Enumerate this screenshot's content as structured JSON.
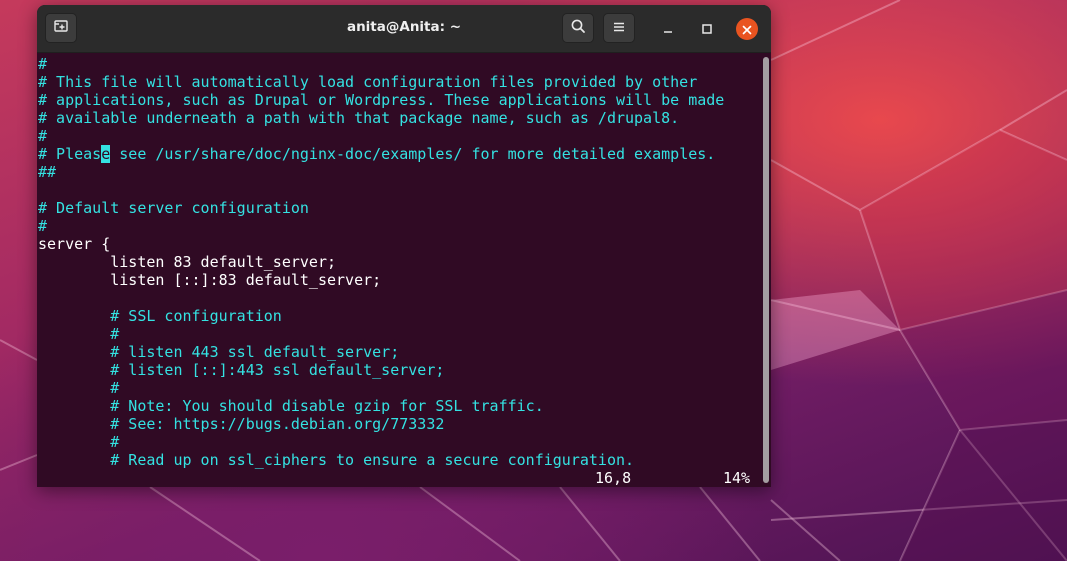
{
  "window": {
    "title": "anita@Anita: ~"
  },
  "icons": {
    "new_tab": "new-tab-icon",
    "search": "search-icon",
    "menu": "hamburger-menu-icon",
    "minimize": "minimize-icon",
    "maximize": "maximize-icon",
    "close": "close-icon"
  },
  "colors": {
    "terminal_bg": "#300a24",
    "comment": "#34e2e2",
    "close_button": "#e95420"
  },
  "editor": {
    "lines": [
      {
        "text": "#",
        "comment": true
      },
      {
        "text": "# This file will automatically load configuration files provided by other",
        "comment": true
      },
      {
        "text": "# applications, such as Drupal or Wordpress. These applications will be made",
        "comment": true
      },
      {
        "text": "# available underneath a path with that package name, such as /drupal8.",
        "comment": true
      },
      {
        "text": "#",
        "comment": true
      },
      {
        "text": "# Please see /usr/share/doc/nginx-doc/examples/ for more detailed examples.",
        "comment": true,
        "cursor": 7
      },
      {
        "text": "##",
        "comment": true
      },
      {
        "text": "",
        "comment": false
      },
      {
        "text": "# Default server configuration",
        "comment": true
      },
      {
        "text": "#",
        "comment": true
      },
      {
        "text": "server {",
        "comment": false
      },
      {
        "text": "        listen 83 default_server;",
        "comment": false
      },
      {
        "text": "        listen [::]:83 default_server;",
        "comment": false
      },
      {
        "text": "",
        "comment": false
      },
      {
        "text": "        # SSL configuration",
        "comment": true
      },
      {
        "text": "        #",
        "comment": true
      },
      {
        "text": "        # listen 443 ssl default_server;",
        "comment": true
      },
      {
        "text": "        # listen [::]:443 ssl default_server;",
        "comment": true
      },
      {
        "text": "        #",
        "comment": true
      },
      {
        "text": "        # Note: You should disable gzip for SSL traffic.",
        "comment": true
      },
      {
        "text": "        # See: https://bugs.debian.org/773332",
        "comment": true
      },
      {
        "text": "        #",
        "comment": true
      },
      {
        "text": "        # Read up on ssl_ciphers to ensure a secure configuration.",
        "comment": true
      }
    ],
    "status": {
      "position": "16,8",
      "percent": "14%"
    }
  }
}
